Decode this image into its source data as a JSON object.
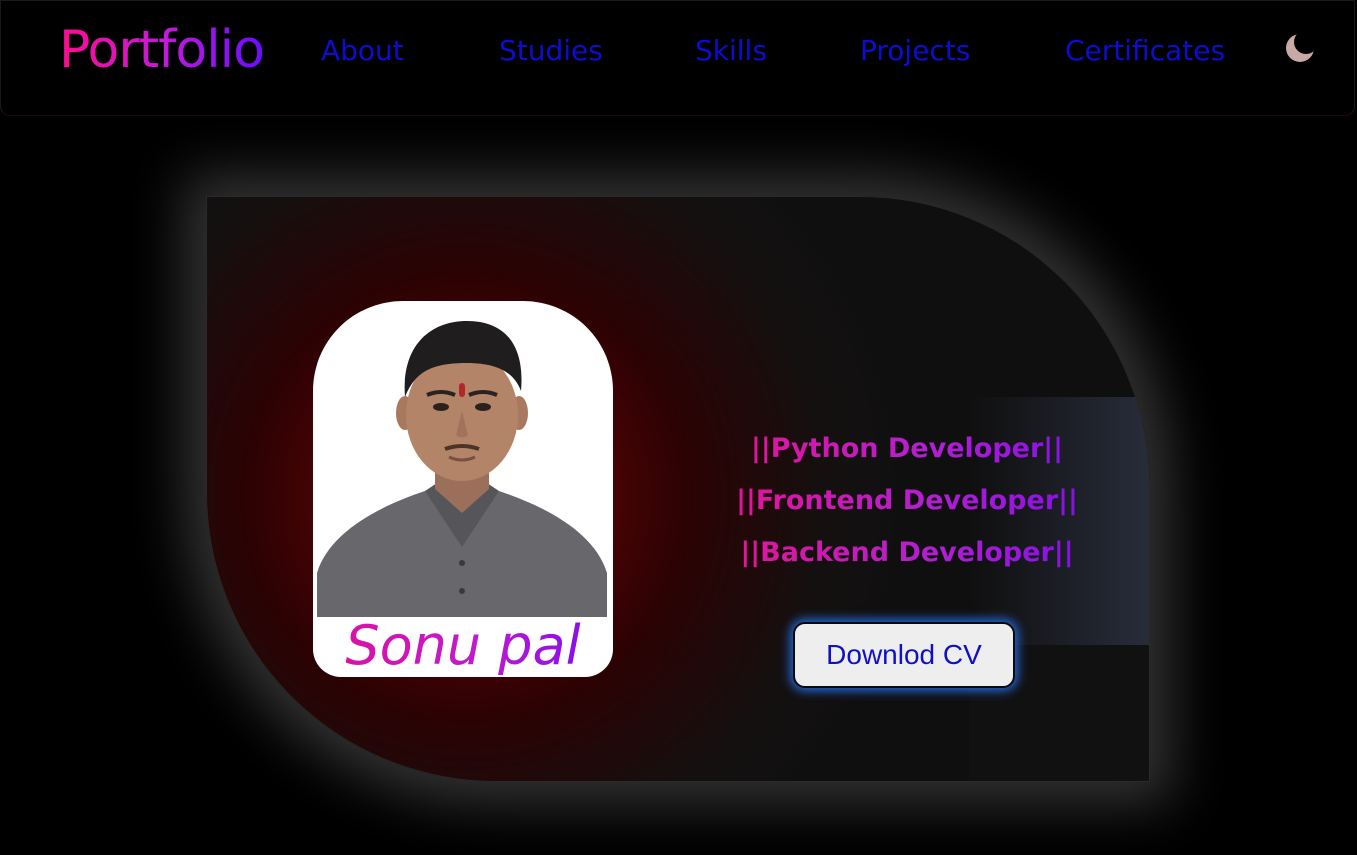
{
  "nav": {
    "logo": "Portfolio",
    "links": [
      "About",
      "Studies",
      "Skills",
      "Projects",
      "Certificates"
    ],
    "theme_toggle_icon": "moon-icon"
  },
  "hero": {
    "name": "Sonu pal",
    "roles": [
      "||Python Developer||",
      "||Frontend Developer||",
      "||Backend Developer||"
    ],
    "cv_button": "Downlod CV"
  },
  "colors": {
    "background": "#000000",
    "nav_link": "#0d0dd2",
    "accent_pink": "#ff0b8e",
    "accent_purple": "#6a0cff",
    "hero_glow_red": "#7a0507",
    "button_glow": "#2878ff"
  }
}
